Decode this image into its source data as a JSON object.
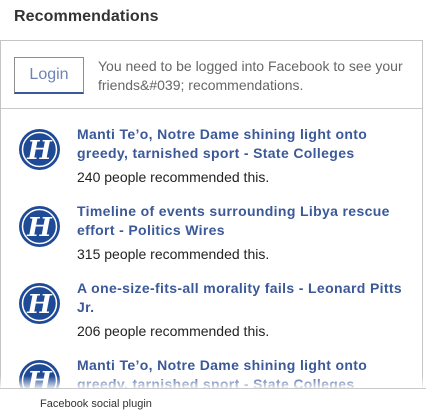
{
  "header": {
    "title": "Recommendations"
  },
  "login": {
    "button_label": "Login",
    "message": "You need to be logged into Facebook to see your friends&#039; recommendations."
  },
  "items": [
    {
      "title": "Manti Te’o, Notre Dame shining light onto greedy, tarnished sport - State Colleges",
      "count": "240 people recommended this.",
      "icon": "herald-logo-icon"
    },
    {
      "title": "Timeline of events surrounding Libya rescue effort - Politics Wires",
      "count": "315 people recommended this.",
      "icon": "herald-logo-icon"
    },
    {
      "title": "A one-size-fits-all morality fails - Leonard Pitts Jr.",
      "count": "206 people recommended this.",
      "icon": "herald-logo-icon"
    },
    {
      "title": "Manti Te’o, Notre Dame shining light onto greedy, tarnished sport - State Colleges",
      "count": "",
      "icon": "herald-logo-icon"
    }
  ],
  "footer": {
    "label": "Facebook social plugin"
  },
  "colors": {
    "link": "#3b5998",
    "logo_blue": "#1f4a96",
    "border": "#c4c4c4"
  }
}
